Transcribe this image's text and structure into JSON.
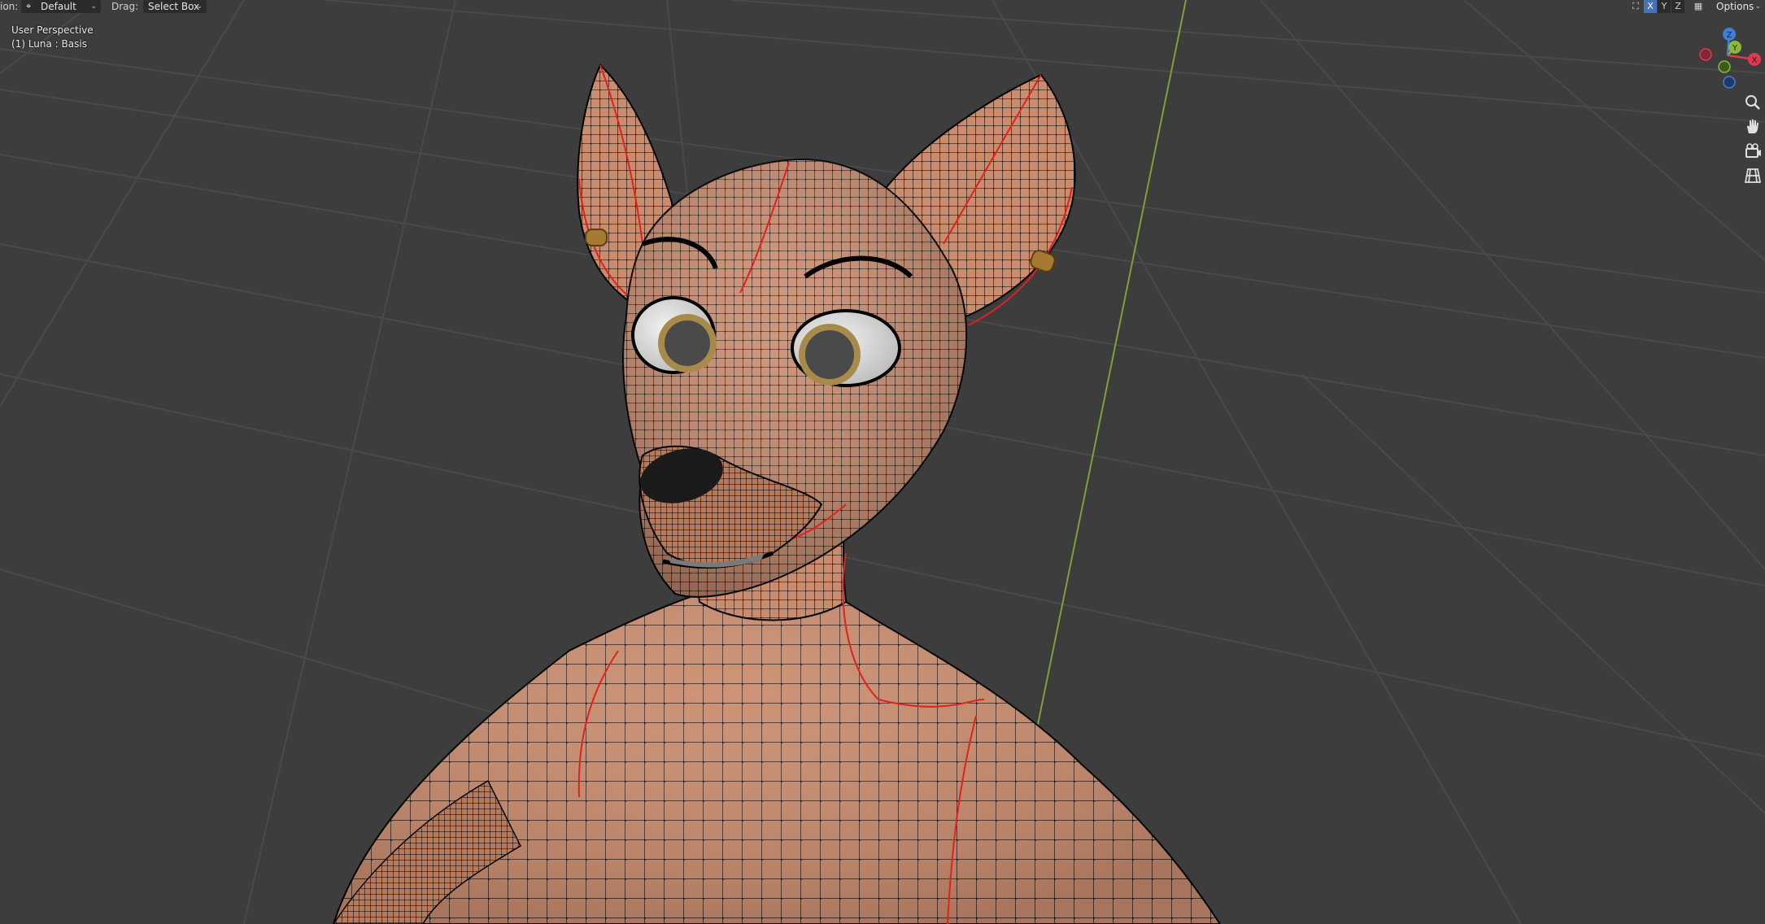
{
  "header": {
    "orientation_label": "ion:",
    "orientation_value": "Default",
    "drag_label": "Drag:",
    "drag_value": "Select Box",
    "axes": [
      "X",
      "Y",
      "Z"
    ],
    "options_label": "Options"
  },
  "overlay": {
    "view_name": "User Perspective",
    "object_info": "(1) Luna : Basis"
  },
  "gizmo": {
    "axis_labels": [
      "X",
      "Y",
      "Z"
    ],
    "tools": [
      "zoom-icon",
      "hand-pan-icon",
      "camera-icon",
      "grid-ortho-icon"
    ]
  },
  "colors": {
    "viewport_bg": "#3d3d3d",
    "grid_line": "#4a4a4a",
    "y_axis_line": "#7fa03a",
    "skin": "#c98c6e",
    "wire": "#000000",
    "seam": "#e0221c",
    "axis_x": "#e0384f",
    "axis_y": "#8ab83a",
    "axis_z": "#3e80d8",
    "header_active_axis": "#4772b3"
  },
  "icons": {
    "transform_pivot": "pivot-icon",
    "chevron": "chevron-down-icon",
    "gizmo_toggle": "gizmo-toggle-icon",
    "overlay_toggle": "overlay-toggle-icon"
  }
}
